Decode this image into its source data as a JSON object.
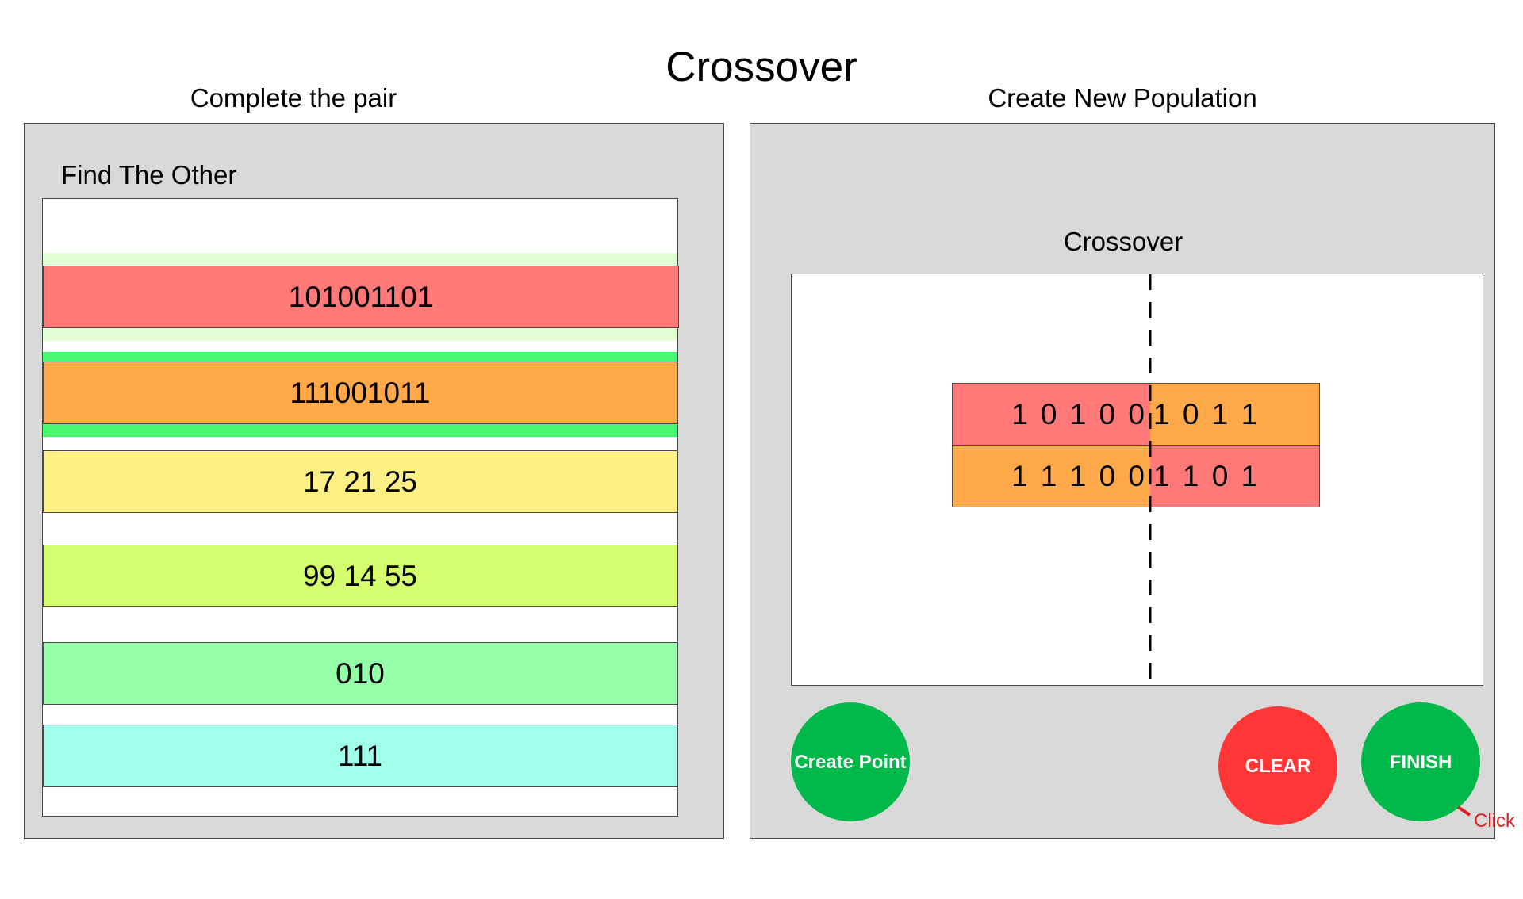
{
  "title": "Crossover",
  "left_panel": {
    "heading": "Complete the pair",
    "subheading": "Find The Other",
    "items": [
      {
        "label": "101001101",
        "color": "#ff7979"
      },
      {
        "label": "111001011",
        "color": "#ffa94a"
      },
      {
        "label": "17 21 25",
        "color": "#fff085"
      },
      {
        "label": "99 14 55",
        "color": "#d4fe6d"
      },
      {
        "label": "010",
        "color": "#95fea9"
      },
      {
        "label": "111",
        "color": "#a1feea"
      }
    ],
    "selected_color": "#48f870",
    "hover_color": "#e0fdd4"
  },
  "right_panel": {
    "heading": "Create New Population",
    "crossover_label": "Crossover",
    "offspring": [
      {
        "left": "1 0 1 0 0",
        "right": "1 0 1 1",
        "left_color": "#ff7979",
        "right_color": "#ffa94a"
      },
      {
        "left": "1 1 1 0 0",
        "right": "1 1 0 1",
        "left_color": "#ffa94a",
        "right_color": "#ff7979"
      }
    ],
    "buttons": {
      "create_point": "Create Point",
      "clear": "CLEAR",
      "finish": "FINISH"
    },
    "hint": "Click",
    "colors": {
      "green": "#00b94a",
      "red": "#ff3636"
    }
  }
}
